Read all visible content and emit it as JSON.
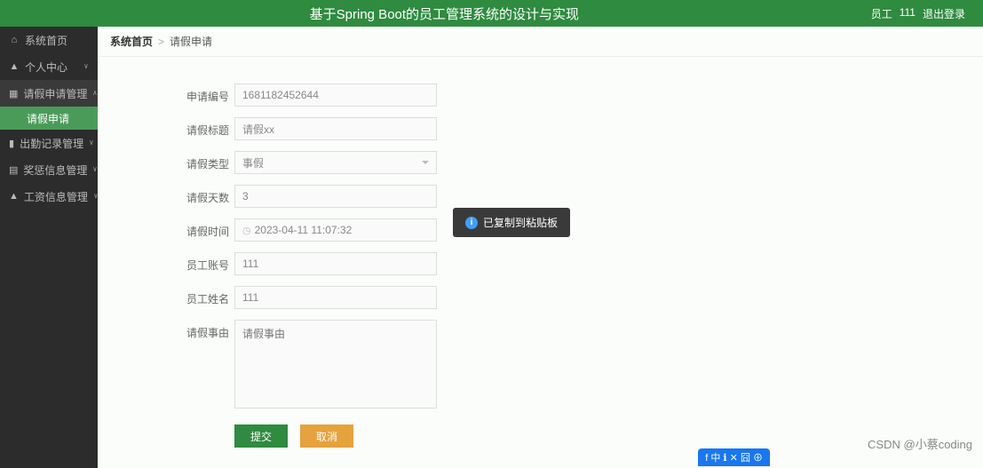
{
  "header": {
    "title": "基于Spring Boot的员工管理系统的设计与实现",
    "user_prefix": "员工",
    "user_name": "111",
    "logout": "退出登录"
  },
  "sidebar": {
    "items": [
      {
        "icon": "home-icon",
        "glyph": "⌂",
        "label": "系统首页",
        "chevron": ""
      },
      {
        "icon": "user-icon",
        "glyph": "▲",
        "label": "个人中心",
        "chevron": "˅"
      },
      {
        "icon": "grid-icon",
        "glyph": "▦",
        "label": "请假申请管理",
        "chevron": "˄",
        "active": true
      },
      {
        "icon": "chart-icon",
        "glyph": "▮",
        "label": "出勤记录管理",
        "chevron": "˅"
      },
      {
        "icon": "monitor-icon",
        "glyph": "▤",
        "label": "奖惩信息管理",
        "chevron": "˅"
      },
      {
        "icon": "person-icon",
        "glyph": "▲",
        "label": "工资信息管理",
        "chevron": "˅"
      }
    ],
    "sub_item": "请假申请"
  },
  "breadcrumb": {
    "home": "系统首页",
    "sep": ">",
    "current": "请假申请"
  },
  "form": {
    "fields": {
      "id": {
        "label": "申请编号",
        "value": "1681182452644"
      },
      "title": {
        "label": "请假标题",
        "value": "请假xx"
      },
      "type": {
        "label": "请假类型",
        "value": "事假"
      },
      "days": {
        "label": "请假天数",
        "value": "3"
      },
      "time": {
        "label": "请假时间",
        "value": "2023-04-11 11:07:32"
      },
      "emp_no": {
        "label": "员工账号",
        "value": "111"
      },
      "emp_name": {
        "label": "员工姓名",
        "value": "111"
      },
      "reason": {
        "label": "请假事由",
        "placeholder": "请假事由"
      }
    },
    "buttons": {
      "submit": "提交",
      "cancel": "取消"
    }
  },
  "toast": {
    "text": "已复制到粘贴板"
  },
  "watermark": "CSDN @小蔡coding",
  "bottom_badge": "f 中 ℹ ✕ 囧 ⊕"
}
